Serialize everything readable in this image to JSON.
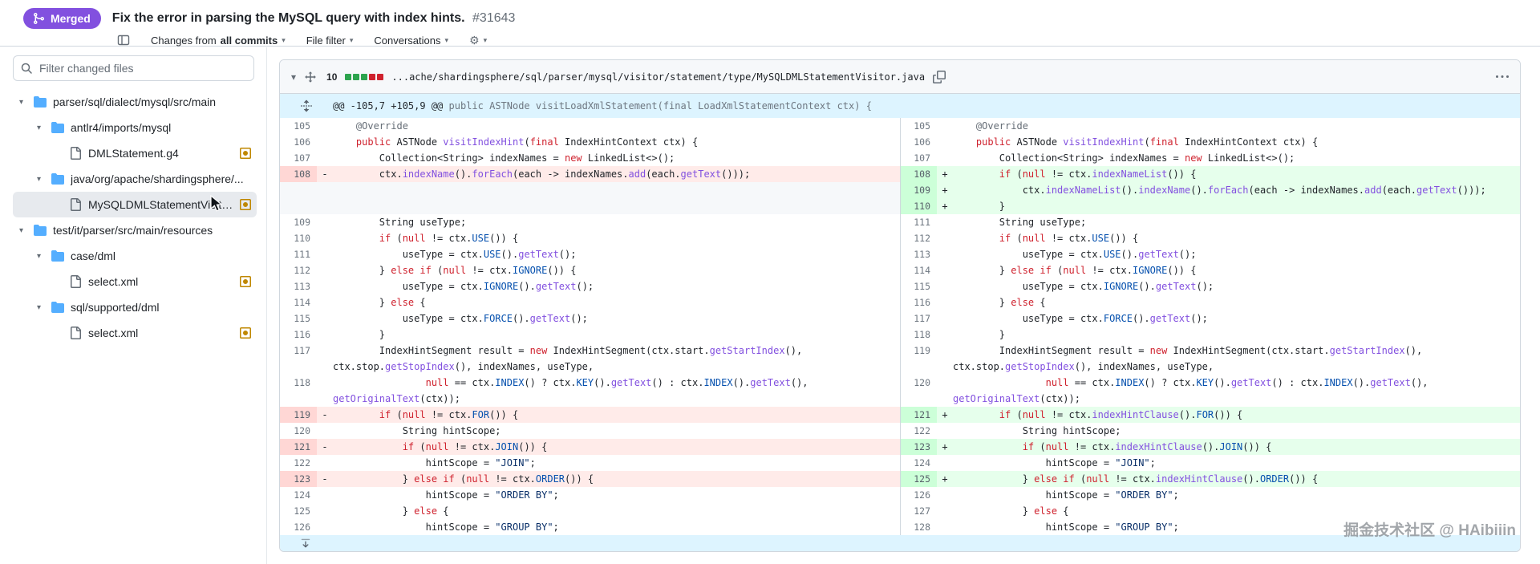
{
  "pr": {
    "status": "Merged",
    "title": "Fix the error in parsing the MySQL query with index hints.",
    "number": "#31643"
  },
  "toolbar": {
    "changes_from": "Changes from",
    "all_commits": "all commits",
    "file_filter": "File filter",
    "conversations": "Conversations"
  },
  "sidebar": {
    "filter_placeholder": "Filter changed files",
    "tree": [
      {
        "type": "folder",
        "label": "parser/sql/dialect/mysql/src/main",
        "depth": 0,
        "modified": false,
        "selected": false
      },
      {
        "type": "folder",
        "label": "antlr4/imports/mysql",
        "depth": 1,
        "modified": false,
        "selected": false
      },
      {
        "type": "file",
        "label": "DMLStatement.g4",
        "depth": 2,
        "modified": true,
        "selected": false
      },
      {
        "type": "folder",
        "label": "java/org/apache/shardingsphere/...",
        "depth": 1,
        "modified": false,
        "selected": false
      },
      {
        "type": "file",
        "label": "MySQLDMLStatementVisito...",
        "depth": 2,
        "modified": true,
        "selected": true
      },
      {
        "type": "folder",
        "label": "test/it/parser/src/main/resources",
        "depth": 0,
        "modified": false,
        "selected": false
      },
      {
        "type": "folder",
        "label": "case/dml",
        "depth": 1,
        "modified": false,
        "selected": false
      },
      {
        "type": "file",
        "label": "select.xml",
        "depth": 2,
        "modified": true,
        "selected": false
      },
      {
        "type": "folder",
        "label": "sql/supported/dml",
        "depth": 1,
        "modified": false,
        "selected": false
      },
      {
        "type": "file",
        "label": "select.xml",
        "depth": 2,
        "modified": true,
        "selected": false
      }
    ]
  },
  "diff": {
    "changed_lines": "10",
    "diffstat": [
      "add",
      "add",
      "add",
      "del",
      "del"
    ],
    "file_path": "...ache/shardingsphere/sql/parser/mysql/visitor/statement/type/MySQLDMLStatementVisitor.java",
    "hunk": {
      "range": "@@ -105,7 +105,9 @@",
      "context": "public ASTNode visitLoadXmlStatement(final LoadXmlStatementContext ctx) {"
    },
    "rows": [
      {
        "l": {
          "n": "105",
          "s": "",
          "k": "context",
          "c": "    @Override"
        },
        "r": {
          "n": "105",
          "s": "",
          "k": "context",
          "c": "    @Override"
        }
      },
      {
        "l": {
          "n": "106",
          "s": "",
          "k": "context",
          "c": "    public ASTNode visitIndexHint(final IndexHintContext ctx) {"
        },
        "r": {
          "n": "106",
          "s": "",
          "k": "context",
          "c": "    public ASTNode visitIndexHint(final IndexHintContext ctx) {"
        }
      },
      {
        "l": {
          "n": "107",
          "s": "",
          "k": "context",
          "c": "        Collection<String> indexNames = new LinkedList<>();"
        },
        "r": {
          "n": "107",
          "s": "",
          "k": "context",
          "c": "        Collection<String> indexNames = new LinkedList<>();"
        }
      },
      {
        "l": {
          "n": "108",
          "s": "-",
          "k": "del",
          "c": "        ctx.indexName().forEach(each -> indexNames.add(each.getText()));"
        },
        "r": {
          "n": "108",
          "s": "+",
          "k": "add",
          "c": "        if (null != ctx.indexNameList()) {"
        }
      },
      {
        "l": {
          "n": "",
          "s": "",
          "k": "empty",
          "c": ""
        },
        "r": {
          "n": "109",
          "s": "+",
          "k": "add",
          "c": "            ctx.indexNameList().indexName().forEach(each -> indexNames.add(each.getText()));"
        }
      },
      {
        "l": {
          "n": "",
          "s": "",
          "k": "empty",
          "c": ""
        },
        "r": {
          "n": "110",
          "s": "+",
          "k": "add",
          "c": "        }"
        }
      },
      {
        "l": {
          "n": "109",
          "s": "",
          "k": "context",
          "c": "        String useType;"
        },
        "r": {
          "n": "111",
          "s": "",
          "k": "context",
          "c": "        String useType;"
        }
      },
      {
        "l": {
          "n": "110",
          "s": "",
          "k": "context",
          "c": "        if (null != ctx.USE()) {"
        },
        "r": {
          "n": "112",
          "s": "",
          "k": "context",
          "c": "        if (null != ctx.USE()) {"
        }
      },
      {
        "l": {
          "n": "111",
          "s": "",
          "k": "context",
          "c": "            useType = ctx.USE().getText();"
        },
        "r": {
          "n": "113",
          "s": "",
          "k": "context",
          "c": "            useType = ctx.USE().getText();"
        }
      },
      {
        "l": {
          "n": "112",
          "s": "",
          "k": "context",
          "c": "        } else if (null != ctx.IGNORE()) {"
        },
        "r": {
          "n": "114",
          "s": "",
          "k": "context",
          "c": "        } else if (null != ctx.IGNORE()) {"
        }
      },
      {
        "l": {
          "n": "113",
          "s": "",
          "k": "context",
          "c": "            useType = ctx.IGNORE().getText();"
        },
        "r": {
          "n": "115",
          "s": "",
          "k": "context",
          "c": "            useType = ctx.IGNORE().getText();"
        }
      },
      {
        "l": {
          "n": "114",
          "s": "",
          "k": "context",
          "c": "        } else {"
        },
        "r": {
          "n": "116",
          "s": "",
          "k": "context",
          "c": "        } else {"
        }
      },
      {
        "l": {
          "n": "115",
          "s": "",
          "k": "context",
          "c": "            useType = ctx.FORCE().getText();"
        },
        "r": {
          "n": "117",
          "s": "",
          "k": "context",
          "c": "            useType = ctx.FORCE().getText();"
        }
      },
      {
        "l": {
          "n": "116",
          "s": "",
          "k": "context",
          "c": "        }"
        },
        "r": {
          "n": "118",
          "s": "",
          "k": "context",
          "c": "        }"
        }
      },
      {
        "l": {
          "n": "117",
          "s": "",
          "k": "context",
          "c": "        IndexHintSegment result = new IndexHintSegment(ctx.start.getStartIndex(),"
        },
        "r": {
          "n": "119",
          "s": "",
          "k": "context",
          "c": "        IndexHintSegment result = new IndexHintSegment(ctx.start.getStartIndex(),"
        }
      },
      {
        "l": {
          "n": "",
          "s": "",
          "k": "context",
          "c": "ctx.stop.getStopIndex(), indexNames, useType,"
        },
        "r": {
          "n": "",
          "s": "",
          "k": "context",
          "c": "ctx.stop.getStopIndex(), indexNames, useType,"
        }
      },
      {
        "l": {
          "n": "118",
          "s": "",
          "k": "context",
          "c": "                null == ctx.INDEX() ? ctx.KEY().getText() : ctx.INDEX().getText(),"
        },
        "r": {
          "n": "120",
          "s": "",
          "k": "context",
          "c": "                null == ctx.INDEX() ? ctx.KEY().getText() : ctx.INDEX().getText(),"
        }
      },
      {
        "l": {
          "n": "",
          "s": "",
          "k": "context",
          "c": "getOriginalText(ctx));"
        },
        "r": {
          "n": "",
          "s": "",
          "k": "context",
          "c": "getOriginalText(ctx));"
        }
      },
      {
        "l": {
          "n": "119",
          "s": "-",
          "k": "del",
          "c": "        if (null != ctx.FOR()) {"
        },
        "r": {
          "n": "121",
          "s": "+",
          "k": "add",
          "c": "        if (null != ctx.indexHintClause().FOR()) {"
        }
      },
      {
        "l": {
          "n": "120",
          "s": "",
          "k": "context",
          "c": "            String hintScope;"
        },
        "r": {
          "n": "122",
          "s": "",
          "k": "context",
          "c": "            String hintScope;"
        }
      },
      {
        "l": {
          "n": "121",
          "s": "-",
          "k": "del",
          "c": "            if (null != ctx.JOIN()) {"
        },
        "r": {
          "n": "123",
          "s": "+",
          "k": "add",
          "c": "            if (null != ctx.indexHintClause().JOIN()) {"
        }
      },
      {
        "l": {
          "n": "122",
          "s": "",
          "k": "context",
          "c": "                hintScope = \"JOIN\";"
        },
        "r": {
          "n": "124",
          "s": "",
          "k": "context",
          "c": "                hintScope = \"JOIN\";"
        }
      },
      {
        "l": {
          "n": "123",
          "s": "-",
          "k": "del",
          "c": "            } else if (null != ctx.ORDER()) {"
        },
        "r": {
          "n": "125",
          "s": "+",
          "k": "add",
          "c": "            } else if (null != ctx.indexHintClause().ORDER()) {"
        }
      },
      {
        "l": {
          "n": "124",
          "s": "",
          "k": "context",
          "c": "                hintScope = \"ORDER BY\";"
        },
        "r": {
          "n": "126",
          "s": "",
          "k": "context",
          "c": "                hintScope = \"ORDER BY\";"
        }
      },
      {
        "l": {
          "n": "125",
          "s": "",
          "k": "context",
          "c": "            } else {"
        },
        "r": {
          "n": "127",
          "s": "",
          "k": "context",
          "c": "            } else {"
        }
      },
      {
        "l": {
          "n": "126",
          "s": "",
          "k": "context",
          "c": "                hintScope = \"GROUP BY\";"
        },
        "r": {
          "n": "128",
          "s": "",
          "k": "context",
          "c": "                hintScope = \"GROUP BY\";"
        }
      }
    ]
  },
  "watermark": "掘金技术社区 @ HAibiiin",
  "colors": {
    "merged": "#8250df",
    "addition": "#2da44e",
    "deletion": "#cf222e",
    "folder": "#54aeff",
    "modified": "#bf8700"
  }
}
